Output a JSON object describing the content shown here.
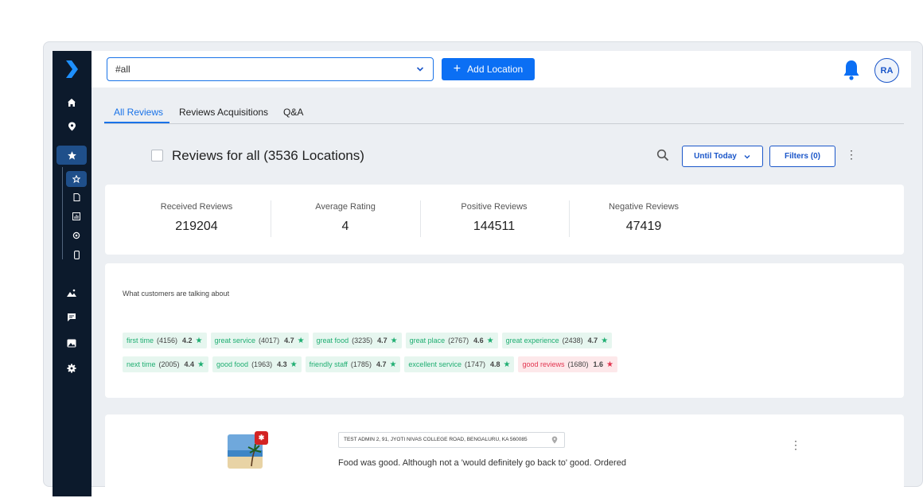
{
  "topbar": {
    "location_select_value": "#all",
    "add_location_label": "Add Location",
    "avatar_initials": "RA"
  },
  "tabs": [
    {
      "label": "All Reviews",
      "active": true
    },
    {
      "label": "Reviews Acquisitions",
      "active": false
    },
    {
      "label": "Q&A",
      "active": false
    }
  ],
  "reviews_header": {
    "title": "Reviews for all (3536 Locations)",
    "date_filter_label": "Until Today",
    "filters_label": "Filters (0)"
  },
  "stats": [
    {
      "label": "Received Reviews",
      "value": "219204"
    },
    {
      "label": "Average Rating",
      "value": "4"
    },
    {
      "label": "Positive Reviews",
      "value": "144511"
    },
    {
      "label": "Negative Reviews",
      "value": "47419"
    }
  ],
  "topics": {
    "title": "What customers are talking about",
    "rows": [
      [
        {
          "keyword": "first time",
          "count": "(4156)",
          "rating": "4.2",
          "sentiment": "pos"
        },
        {
          "keyword": "great service",
          "count": "(4017)",
          "rating": "4.7",
          "sentiment": "pos"
        },
        {
          "keyword": "great food",
          "count": "(3235)",
          "rating": "4.7",
          "sentiment": "pos"
        },
        {
          "keyword": "great place",
          "count": "(2767)",
          "rating": "4.6",
          "sentiment": "pos"
        },
        {
          "keyword": "great experience",
          "count": "(2438)",
          "rating": "4.7",
          "sentiment": "pos"
        }
      ],
      [
        {
          "keyword": "next time",
          "count": "(2005)",
          "rating": "4.4",
          "sentiment": "pos"
        },
        {
          "keyword": "good food",
          "count": "(1963)",
          "rating": "4.3",
          "sentiment": "pos"
        },
        {
          "keyword": "friendly staff",
          "count": "(1785)",
          "rating": "4.7",
          "sentiment": "pos"
        },
        {
          "keyword": "excellent service",
          "count": "(1747)",
          "rating": "4.8",
          "sentiment": "pos"
        },
        {
          "keyword": "good reviews",
          "count": "(1680)",
          "rating": "1.6",
          "sentiment": "neg"
        }
      ]
    ]
  },
  "review": {
    "address": "TEST ADMIN 2, 91, JYOTI NIVAS COLLEGE ROAD, BENGALURU, KA 560085",
    "text": "Food was good. Although not a 'would definitely go back to' good. Ordered"
  },
  "colors": {
    "sidebar": "#0c1a2c",
    "primary": "#0b6ff4",
    "positive": "#1fae72",
    "negative": "#e2344f"
  },
  "icons": {
    "sidebar": [
      "home-icon",
      "location-pin-icon",
      "star-icon",
      "star-outline-icon",
      "document-icon",
      "chart-icon",
      "settings-icon",
      "phone-icon",
      "image-icon",
      "chat-icon",
      "photo-icon",
      "gear-icon"
    ],
    "topbar": [
      "chevron-down-icon",
      "plus-icon",
      "bell-icon"
    ]
  }
}
